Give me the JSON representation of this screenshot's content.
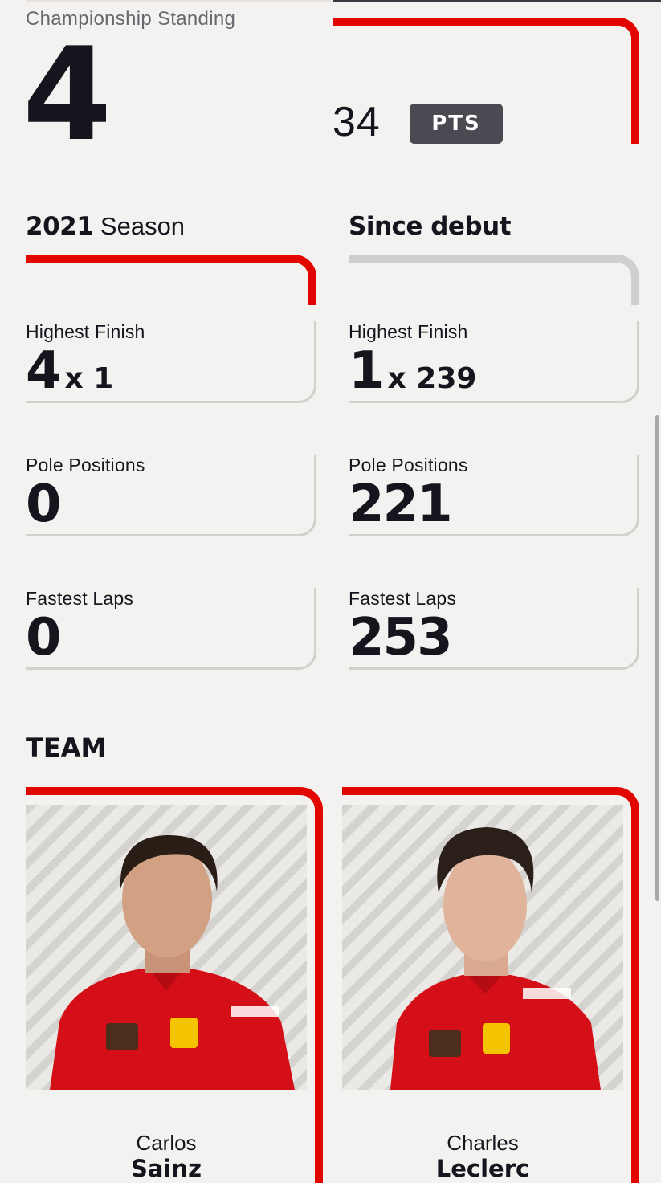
{
  "championship": {
    "label": "Championship Standing",
    "position": "4",
    "points": "34",
    "points_unit": "PTS"
  },
  "season": {
    "year": "2021",
    "label": "Season",
    "since_debut_label": "Since debut"
  },
  "stats_season": [
    {
      "label": "Highest Finish",
      "value": "4",
      "multiplier": "x 1"
    },
    {
      "label": "Pole Positions",
      "value": "0",
      "multiplier": ""
    },
    {
      "label": "Fastest Laps",
      "value": "0",
      "multiplier": ""
    }
  ],
  "stats_debut": [
    {
      "label": "Highest Finish",
      "value": "1",
      "multiplier": "x 239"
    },
    {
      "label": "Pole Positions",
      "value": "221",
      "multiplier": ""
    },
    {
      "label": "Fastest Laps",
      "value": "253",
      "multiplier": ""
    }
  ],
  "team": {
    "title": "TEAM",
    "drivers": [
      {
        "first_name": "Carlos",
        "last_name": "Sainz",
        "suit_color": "#d40f17",
        "hair_color": "#2a1d16"
      },
      {
        "first_name": "Charles",
        "last_name": "Leclerc",
        "suit_color": "#d40f17",
        "hair_color": "#2b1f19"
      }
    ]
  },
  "colors": {
    "accent": "#e10600",
    "background": "#f4f2f0",
    "text": "#15151e",
    "badge": "#4a4a52"
  }
}
